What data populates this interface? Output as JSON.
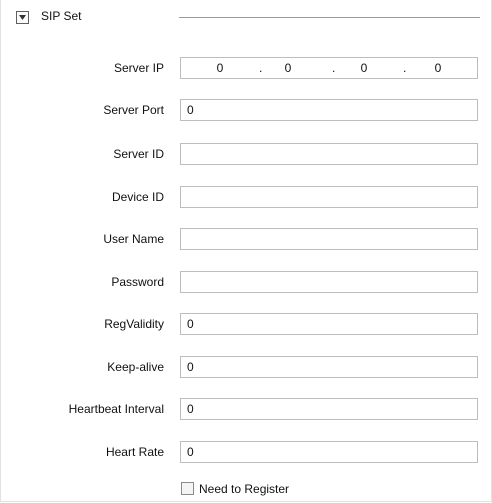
{
  "section": {
    "title": "SIP Set",
    "collapse_icon": "chevron-down-icon"
  },
  "server_ip": {
    "label": "Server IP",
    "octets": [
      "0",
      "0",
      "0",
      "0"
    ],
    "separator": "."
  },
  "fields": [
    {
      "label": "Server Port",
      "value": "0"
    },
    {
      "label": "Server ID",
      "value": ""
    },
    {
      "label": "Device ID",
      "value": ""
    },
    {
      "label": "User Name",
      "value": ""
    },
    {
      "label": "Password",
      "value": ""
    },
    {
      "label": "RegValidity",
      "value": "0"
    },
    {
      "label": "Keep-alive",
      "value": "0"
    },
    {
      "label": "Heartbeat Interval",
      "value": "0"
    },
    {
      "label": "Heart Rate",
      "value": "0"
    }
  ],
  "need_register": {
    "label": "Need to Register",
    "checked": false
  }
}
